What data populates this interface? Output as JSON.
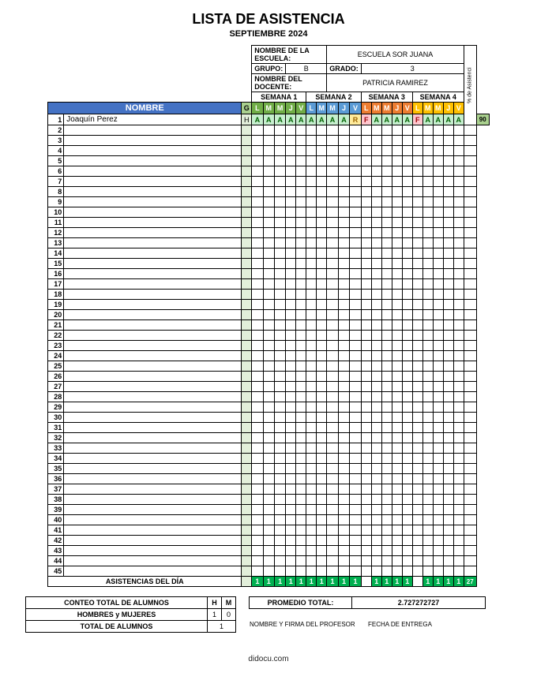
{
  "title": "LISTA DE ASISTENCIA",
  "subtitle": "SEPTIEMBRE 2024",
  "info": {
    "school_label": "NOMBRE DE LA ESCUELA:",
    "school_value": "ESCUELA SOR JUANA",
    "group_label": "GRUPO:",
    "group_value": "B",
    "grade_label": "GRADO:",
    "grade_value": "3",
    "teacher_label": "NOMBRE DEL DOCENTE:",
    "teacher_value": "PATRICIA RAMIREZ",
    "pct_hdr": "% de Asistenci"
  },
  "weeks": [
    "SEMANA 1",
    "SEMANA 2",
    "SEMANA 3",
    "SEMANA 4"
  ],
  "days": [
    "L",
    "M",
    "M",
    "J",
    "V"
  ],
  "name_hdr": "NOMBRE",
  "g_hdr": "G",
  "rows": 45,
  "student": {
    "num": "1",
    "name": "Joaquín Perez",
    "g": "H",
    "marks": [
      "A",
      "A",
      "A",
      "A",
      "A",
      "A",
      "A",
      "A",
      "A",
      "R",
      "F",
      "A",
      "A",
      "A",
      "A",
      "F",
      "A",
      "A",
      "A",
      "A"
    ],
    "pct": "90"
  },
  "day_totals_label": "ASISTENCIAS DEL DÍA",
  "day_totals": [
    "1",
    "1",
    "1",
    "1",
    "1",
    "1",
    "1",
    "1",
    "1",
    "1",
    "",
    "1",
    "1",
    "1",
    "1",
    "",
    "1",
    "1",
    "1",
    "1"
  ],
  "day_totals_last": "27",
  "bottom": {
    "conteo": "CONTEO TOTAL DE ALUMNOS",
    "h": "H",
    "m": "M",
    "hym": "HOMBRES y MUJERES",
    "hcount": "1",
    "mcount": "0",
    "total_label": "TOTAL DE ALUMNOS",
    "total_value": "1",
    "promedio_label": "PROMEDIO TOTAL:",
    "promedio_value": "2.727272727",
    "sig1": "NOMBRE Y FIRMA DEL PROFESOR",
    "sig2": "FECHA DE ENTREGA"
  },
  "footer": "didocu.com"
}
